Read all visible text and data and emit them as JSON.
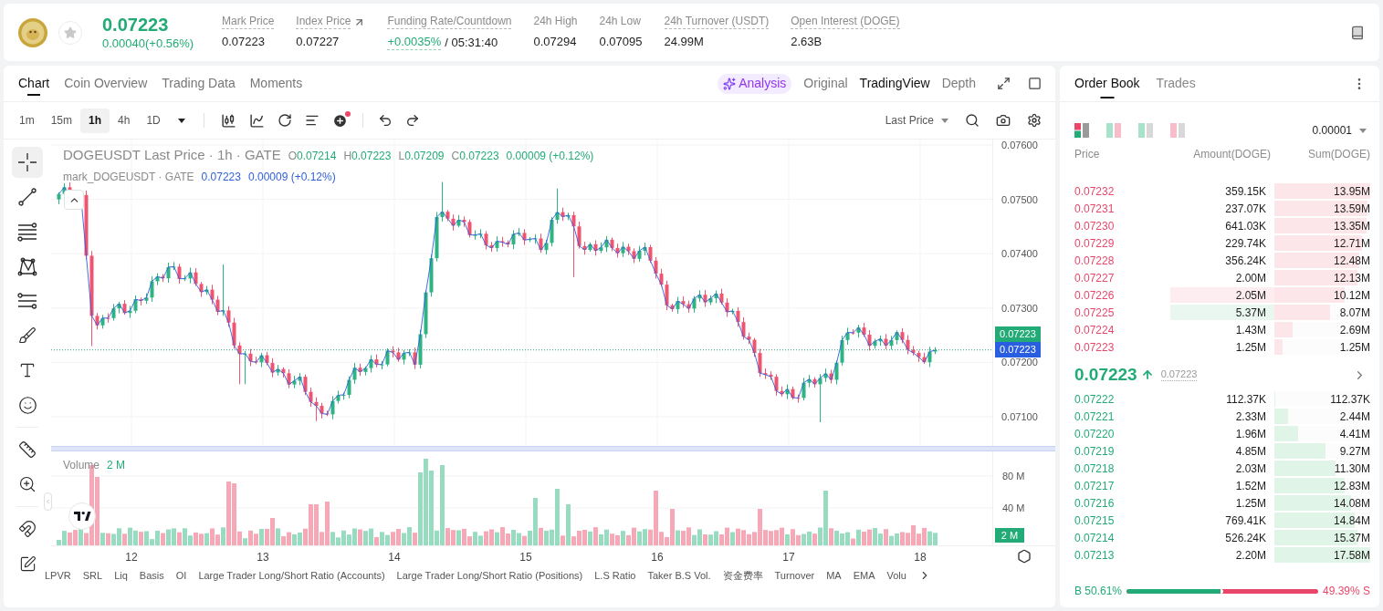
{
  "header": {
    "favorite": false,
    "price": "0.07223",
    "change": "0.00040(+0.56%)",
    "rising": true,
    "stats": [
      {
        "label": "Mark Price",
        "value": "0.07223",
        "tooltip": true,
        "kind": "plain"
      },
      {
        "label": "Index Price",
        "value": "0.07227",
        "tooltip": true,
        "kind": "link"
      },
      {
        "label": "Funding Rate/Countdown",
        "value": "+0.0035%",
        "countdown": "/ 05:31:40",
        "tooltip": true,
        "kind": "funding"
      },
      {
        "label": "24h High",
        "value": "0.07294",
        "tooltip": false,
        "kind": "plain"
      },
      {
        "label": "24h Low",
        "value": "0.07095",
        "tooltip": false,
        "kind": "plain"
      },
      {
        "label": "24h Turnover (USDT)",
        "value": "24.99M",
        "tooltip": true,
        "kind": "plain"
      },
      {
        "label": "Open Interest (DOGE)",
        "value": "2.63B",
        "tooltip": true,
        "kind": "plain"
      }
    ]
  },
  "chart_panel": {
    "tabs": [
      {
        "label": "Chart",
        "selected": true
      },
      {
        "label": "Coin Overview",
        "selected": false
      },
      {
        "label": "Trading Data",
        "selected": false
      },
      {
        "label": "Moments",
        "selected": false
      }
    ],
    "analysis": {
      "label": "Analysis"
    },
    "views": [
      {
        "label": "Original",
        "selected": false
      },
      {
        "label": "TradingView",
        "selected": true
      },
      {
        "label": "Depth",
        "selected": false
      }
    ],
    "intervals": [
      {
        "label": "1m",
        "selected": false
      },
      {
        "label": "15m",
        "selected": false
      },
      {
        "label": "1h",
        "selected": true
      },
      {
        "label": "4h",
        "selected": false
      },
      {
        "label": "1D",
        "selected": false
      }
    ],
    "price_source": "Last Price",
    "tool_groups": [
      {
        "tools": [
          {
            "kind": "crosshair",
            "selected": true
          },
          {
            "kind": "trend_line",
            "selected": false
          },
          {
            "kind": "fib",
            "selected": false
          },
          {
            "kind": "pattern",
            "selected": false
          },
          {
            "kind": "channel",
            "selected": false
          },
          {
            "kind": "brush",
            "selected": false
          },
          {
            "kind": "text",
            "selected": false
          },
          {
            "kind": "emoji",
            "selected": false
          }
        ]
      },
      {
        "tools": [
          {
            "kind": "ruler",
            "selected": false
          },
          {
            "kind": "zoom",
            "selected": false
          }
        ]
      },
      {
        "tools": [
          {
            "kind": "magnet",
            "selected": false
          },
          {
            "kind": "pencil",
            "selected": false
          }
        ]
      }
    ],
    "legend": {
      "title": "DOGEUSDT Last Price · 1h · GATE",
      "ohlc": [
        {
          "key": "O",
          "value": "0.07214"
        },
        {
          "key": "H",
          "value": "0.07223"
        },
        {
          "key": "L",
          "value": "0.07209"
        },
        {
          "key": "C",
          "value": "0.07223"
        }
      ],
      "change": "0.00009 (+0.12%)",
      "mark_title": "mark_DOGEUSDT · GATE",
      "mark_value": "0.07223",
      "mark_change": "0.00009 (+0.12%)"
    },
    "price_axis": [
      "0.07600",
      "0.07500",
      "0.07400",
      "0.07300",
      "0.07200",
      "0.07100"
    ],
    "price_tags": [
      {
        "value": "0.07223",
        "kind": "last"
      },
      {
        "value": "0.07223",
        "kind": "mark"
      }
    ],
    "volume": {
      "title": "Volume",
      "value": "2 M",
      "axis": [
        "80 M",
        "40 M"
      ],
      "tag": "2 M"
    },
    "time_axis": [
      "12",
      "13",
      "14",
      "15",
      "16",
      "17",
      "18"
    ],
    "indicators": [
      "LPVR",
      "SRL",
      "Liq",
      "Basis",
      "OI",
      "Large Trader Long/Short Ratio (Accounts)",
      "Large Trader Long/Short Ratio (Positions)",
      "L.S Ratio",
      "Taker B.S Vol.",
      "资金费率",
      "Turnover",
      "MA",
      "EMA",
      "Volu"
    ]
  },
  "order_book": {
    "tabs": [
      {
        "label": "Order Book",
        "selected": true
      },
      {
        "label": "Trades",
        "selected": false
      }
    ],
    "layouts": [
      {
        "kind": "both",
        "selected": true
      },
      {
        "kind": "split",
        "selected": false
      },
      {
        "kind": "bids",
        "selected": false
      },
      {
        "kind": "asks",
        "selected": false
      }
    ],
    "precision": "0.00001",
    "columns": [
      "Price",
      "Amount(DOGE)",
      "Sum(DOGE)"
    ],
    "asks": [
      {
        "price": "0.07232",
        "amount": "359.15K",
        "sum": "13.95M",
        "level": 1.0
      },
      {
        "price": "0.07231",
        "amount": "237.07K",
        "sum": "13.59M",
        "level": 0.97
      },
      {
        "price": "0.07230",
        "amount": "641.03K",
        "sum": "13.35M",
        "level": 0.96
      },
      {
        "price": "0.07229",
        "amount": "229.74K",
        "sum": "12.71M",
        "level": 0.91
      },
      {
        "price": "0.07228",
        "amount": "356.24K",
        "sum": "12.48M",
        "level": 0.89
      },
      {
        "price": "0.07227",
        "amount": "2.00M",
        "sum": "12.13M",
        "level": 0.87
      },
      {
        "price": "0.07226",
        "amount": "2.05M",
        "sum": "10.12M",
        "level": 0.73,
        "color": "#fdedf0"
      },
      {
        "price": "0.07225",
        "amount": "5.37M",
        "sum": "8.07M",
        "level": 0.58,
        "color": "#eaf7f0"
      },
      {
        "price": "0.07224",
        "amount": "1.43M",
        "sum": "2.69M",
        "level": 0.19
      },
      {
        "price": "0.07223",
        "amount": "1.25M",
        "sum": "1.25M",
        "level": 0.09
      }
    ],
    "mid": {
      "price": "0.07223",
      "mark": "0.07223",
      "rising": true
    },
    "bids": [
      {
        "price": "0.07222",
        "amount": "112.37K",
        "sum": "112.37K",
        "level": 0.01
      },
      {
        "price": "0.07221",
        "amount": "2.33M",
        "sum": "2.44M",
        "level": 0.14
      },
      {
        "price": "0.07220",
        "amount": "1.96M",
        "sum": "4.41M",
        "level": 0.25
      },
      {
        "price": "0.07219",
        "amount": "4.85M",
        "sum": "9.27M",
        "level": 0.53
      },
      {
        "price": "0.07218",
        "amount": "2.03M",
        "sum": "11.30M",
        "level": 0.64
      },
      {
        "price": "0.07217",
        "amount": "1.52M",
        "sum": "12.83M",
        "level": 0.73
      },
      {
        "price": "0.07216",
        "amount": "1.25M",
        "sum": "14.08M",
        "level": 0.8
      },
      {
        "price": "0.07215",
        "amount": "769.41K",
        "sum": "14.84M",
        "level": 0.84
      },
      {
        "price": "0.07214",
        "amount": "526.24K",
        "sum": "15.37M",
        "level": 0.87
      },
      {
        "price": "0.07213",
        "amount": "2.20M",
        "sum": "17.58M",
        "level": 1.0
      }
    ],
    "ratio": {
      "buy": "B 50.61%",
      "sell": "49.39% S",
      "level": 0.5061
    }
  }
}
